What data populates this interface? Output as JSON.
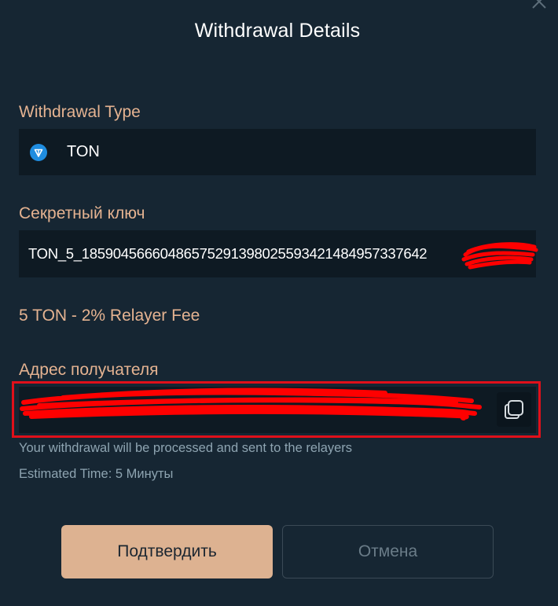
{
  "modal": {
    "title": "Withdrawal Details",
    "close_icon": "close-icon"
  },
  "withdrawal_type": {
    "label": "Withdrawal Type",
    "value": "TON",
    "icon": "ton-diamond-icon",
    "icon_color": "#1f8de0"
  },
  "secret_key": {
    "label": "Секретный ключ",
    "value": "TON_5_18590456660486575291398025593421484957337642"
  },
  "fee": {
    "text": "5 TON - 2% Relayer Fee"
  },
  "recipient": {
    "label": "Адрес получателя",
    "copy_icon": "copy-icon"
  },
  "info": {
    "processed": "Your withdrawal will be processed and sent to the relayers",
    "estimated": "Estimated Time: 5 Минуты"
  },
  "buttons": {
    "confirm": "Подтвердить",
    "cancel": "Отмена"
  },
  "colors": {
    "background": "#162633",
    "field": "#0e1a23",
    "accent": "#e5b391",
    "confirm_button": "#ddb291",
    "redaction": "#ff0000",
    "highlight_frame": "#e0101a"
  }
}
